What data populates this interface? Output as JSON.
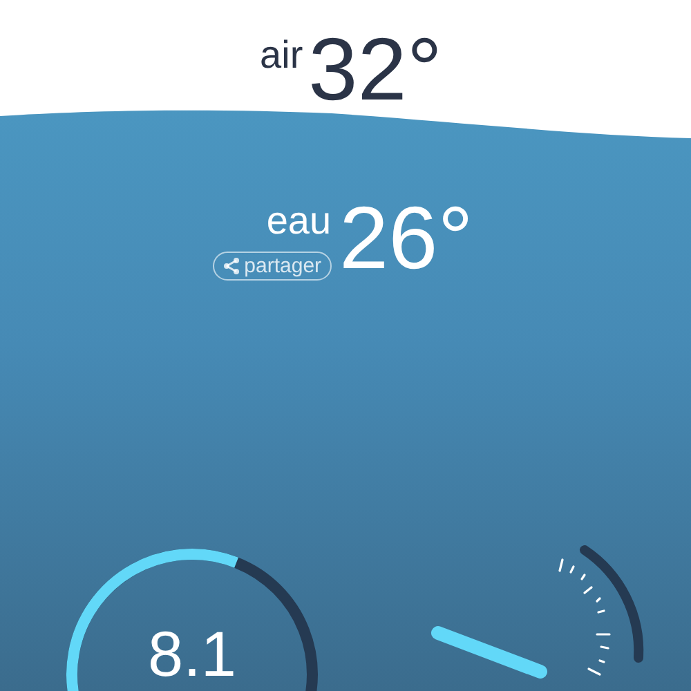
{
  "air": {
    "label": "air",
    "value": "32°"
  },
  "water": {
    "label": "eau",
    "value": "26°"
  },
  "share_button": {
    "label": "partager"
  },
  "gauge": {
    "value": "8.1"
  }
}
